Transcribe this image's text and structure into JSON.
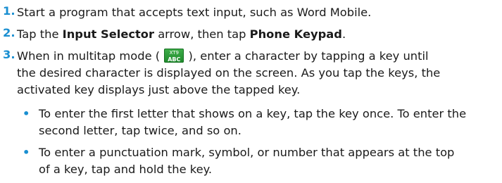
{
  "steps": [
    {
      "number": "1.",
      "text": "Start a program that accepts text input, such as Word Mobile."
    },
    {
      "number": "2.",
      "pre": "Tap the ",
      "bold1": "Input Selector",
      "mid": " arrow, then tap ",
      "bold2": "Phone Keypad",
      "post": "."
    },
    {
      "number": "3.",
      "line1_pre": "When in multitap mode ( ",
      "line1_post": " ), enter a character by tapping a key until",
      "line2": "the desired character is displayed on the screen. As you tap the keys, the",
      "line3": "activated key displays just above the tapped key.",
      "icon": {
        "name": "xt9-abc-icon",
        "top_label": "XT9",
        "bottom_label": "ABC",
        "color": "#2a9c37"
      }
    }
  ],
  "bullets": [
    {
      "symbol": "•",
      "line1": "To enter the first letter that shows on a key, tap the key once. To enter the",
      "line2": "second letter, tap twice, and so on."
    },
    {
      "symbol": "•",
      "line1": "To enter a punctuation mark, symbol, or number that appears at the top",
      "line2": "of a key, tap and hold the key."
    }
  ],
  "colors": {
    "accent": "#1a8fd1",
    "text": "#1a1a1a"
  }
}
